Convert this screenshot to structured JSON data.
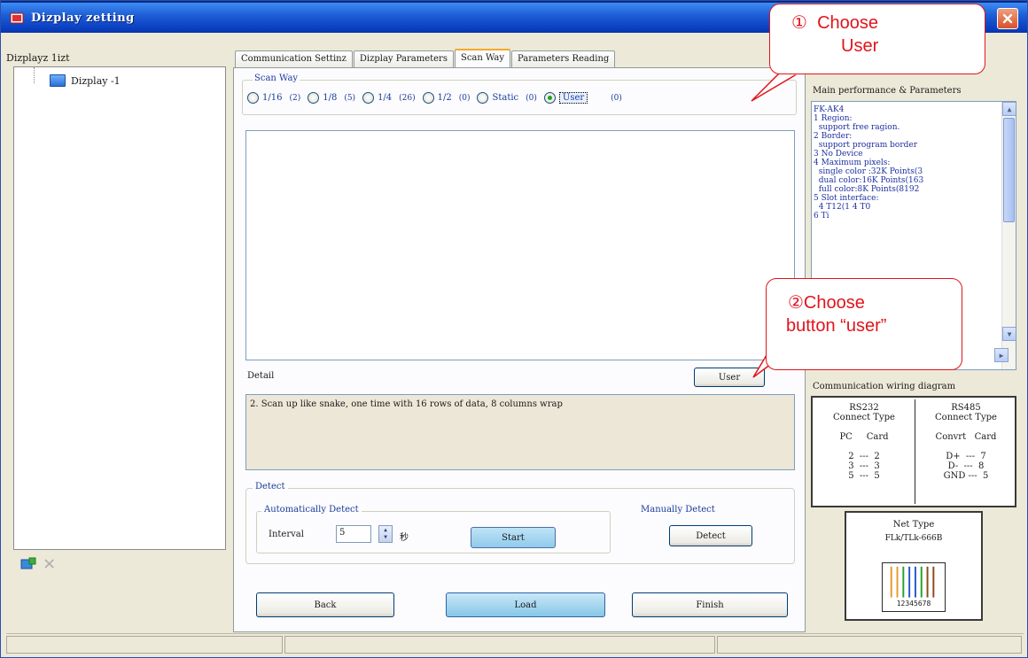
{
  "window": {
    "title": "Dizplay zetting"
  },
  "left": {
    "label": "Dizplayz 1izt",
    "display_item": "Dizplay -1"
  },
  "tabs": [
    {
      "label": "Communication Settinz",
      "active": false
    },
    {
      "label": "Dizplay Parameters",
      "active": false
    },
    {
      "label": "Scan Way",
      "active": true
    },
    {
      "label": "Parameters Reading",
      "active": false
    }
  ],
  "scan_way": {
    "label": "Scan Way",
    "options": [
      {
        "label": "1/16",
        "count": "(2)",
        "selected": false
      },
      {
        "label": "1/8",
        "count": "(5)",
        "selected": false
      },
      {
        "label": "1/4",
        "count": "(26)",
        "selected": false
      },
      {
        "label": "1/2",
        "count": "(0)",
        "selected": false
      },
      {
        "label": "Static",
        "count": "(0)",
        "selected": false
      },
      {
        "label": "User",
        "count": "(0)",
        "selected": true
      }
    ]
  },
  "detail": {
    "label": "Detail",
    "user_button": "User",
    "text": "2. Scan up like snake, one time with 16 rows of data, 8 columns wrap"
  },
  "detect": {
    "label": "Detect",
    "auto_label": "Automatically Detect",
    "manual_label": "Manually Detect",
    "interval_label": "Interval",
    "interval_value": "5",
    "interval_unit": "秒",
    "start_button": "Start",
    "detect_button": "Detect"
  },
  "buttons": {
    "back": "Back",
    "load": "Load",
    "finish": "Finish"
  },
  "performance": {
    "label": "Main performance & Parameters",
    "text": "FK-AK4\n1 Region:\n  support free ragion.\n2 Border:\n  support program border\n3 No Device\n4 Maximum pixels:\n  single color :32K Points(3\n  dual color:16K Points(163\n  full color:8K Points(8192\n5 Slot interface:\n  4 T12(1 4 T0\n6 Ti\n"
  },
  "communication": {
    "label": "Communication wiring diagram",
    "rs232": "RS232\nConnect Type\n\nPC     Card\n\n2  ---  2\n3  ---  3\n5  ---  5",
    "rs485": "RS485\nConnect Type\n\nConvrt   Card\n\nD+  ---  7\nD-  ---  8\nGND ---  5"
  },
  "net": {
    "title": "Net Type",
    "subtitle": "FLk/TLk-666B",
    "pins": "12345678"
  },
  "callouts": {
    "one_prefix": "①",
    "one_line1": "Choose",
    "one_line2": "User",
    "two_line1": "②Choose",
    "two_line2": "button “user”"
  },
  "colors": {
    "titlebar": "#0a3fc2",
    "callout": "#e0141c",
    "accent_button": "#8fcbea"
  }
}
